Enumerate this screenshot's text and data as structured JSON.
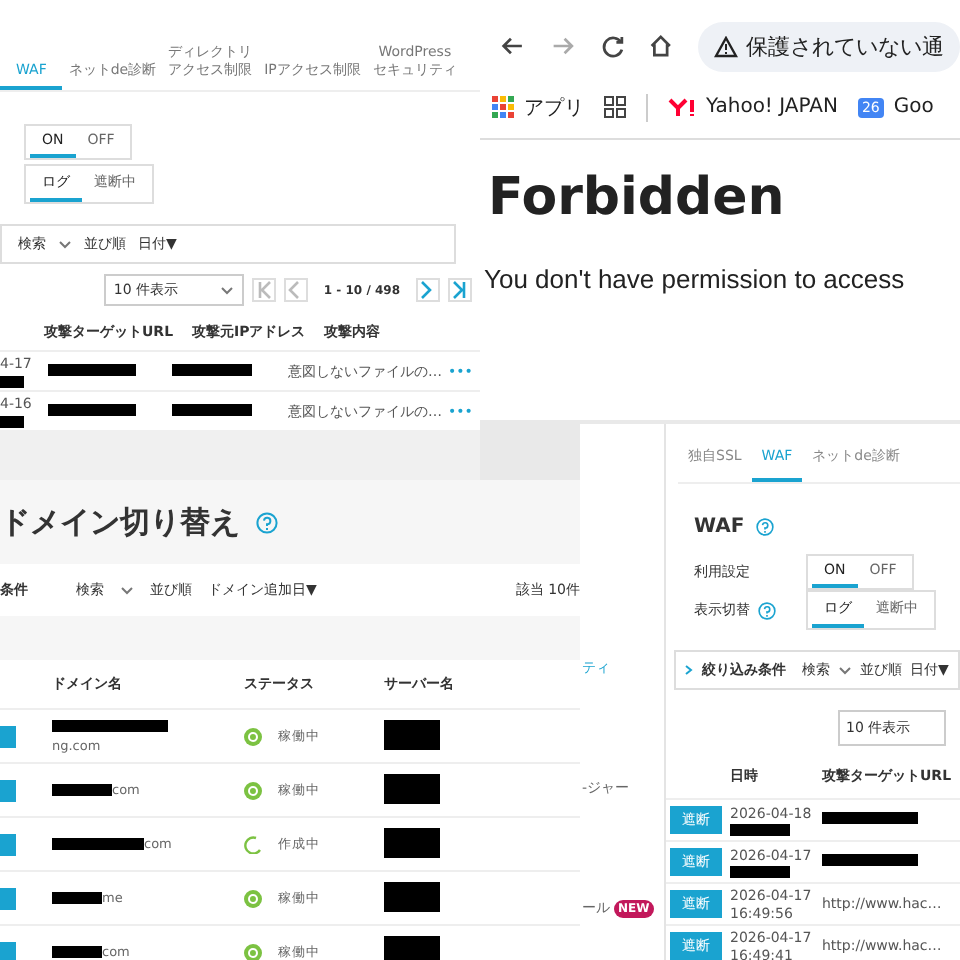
{
  "waf_screen": {
    "tabs": [
      {
        "lines": [
          "WAF"
        ],
        "selected": true
      },
      {
        "lines": [
          "ネットde診断"
        ],
        "selected": false
      },
      {
        "lines": [
          "ディレクトリ",
          "アクセス制限"
        ],
        "selected": false
      },
      {
        "lines": [
          "IPアクセス制限"
        ],
        "selected": false
      },
      {
        "lines": [
          "WordPress",
          "セキュリティ"
        ],
        "selected": false
      }
    ],
    "toggles": [
      [
        {
          "label": "ON",
          "selected": true
        },
        {
          "label": "OFF",
          "selected": false
        }
      ],
      [
        {
          "label": "ログ",
          "selected": true
        },
        {
          "label": "遮断中",
          "selected": false
        }
      ]
    ],
    "filter": {
      "search": "検索",
      "sort_label": "並び順",
      "sort_value": "日付▼"
    },
    "pagination": {
      "page_size": "10 件表示",
      "range": "1 - 10 / 498",
      "buttons": [
        {
          "kind": "first",
          "disabled": true
        },
        {
          "kind": "prev",
          "disabled": true
        },
        {
          "kind": "next",
          "disabled": false
        },
        {
          "kind": "last",
          "disabled": false
        }
      ]
    },
    "columns": [
      "攻撃ターゲットURL",
      "攻撃元IPアドレス",
      "攻撃内容"
    ],
    "rows": [
      {
        "date": "4-17",
        "detail": "意図しないファイルの…",
        "more": "•••"
      },
      {
        "date": "4-16",
        "detail": "意図しないファイルの…",
        "more": "•••"
      }
    ]
  },
  "browser": {
    "address": "保護されていない通",
    "bookmarks": [
      {
        "kind": "apps",
        "label": "アプリ"
      },
      {
        "kind": "grid"
      },
      {
        "kind": "yahoo",
        "label": "Yahoo! JAPAN"
      },
      {
        "kind": "calendar",
        "label": "Goo",
        "icon_text": "26"
      }
    ],
    "heading": "Forbidden",
    "message": "You don't have permission to access "
  },
  "domain_screen": {
    "title": "ドメイン切り替え",
    "filter": {
      "label": "条件",
      "search": "検索",
      "sort_label": "並び順",
      "sort_value": "ドメイン追加日▼",
      "count": "該当 10件"
    },
    "columns": [
      "ドメイン名",
      "ステータス",
      "サーバー名"
    ],
    "rows": [
      {
        "domain": "ng.com",
        "status": "稼働中",
        "kind": "running"
      },
      {
        "domain": "com",
        "status": "稼働中",
        "kind": "running"
      },
      {
        "domain": "com",
        "status": "作成中",
        "kind": "creating"
      },
      {
        "domain": "me",
        "status": "稼働中",
        "kind": "running"
      },
      {
        "domain": "com",
        "status": "稼働中",
        "kind": "running"
      }
    ]
  },
  "side_menu": {
    "items": [
      {
        "label": "ティ"
      },
      {
        "label": "-ジャー"
      },
      {
        "label": "ール",
        "badge": "NEW"
      }
    ]
  },
  "waf_screen_2": {
    "tabs": [
      {
        "label": "独自SSL",
        "selected": false
      },
      {
        "label": "WAF",
        "selected": true
      },
      {
        "label": "ネットde診断",
        "selected": false
      }
    ],
    "heading": "WAF",
    "settings": [
      {
        "label": "利用設定",
        "help": false,
        "options": [
          {
            "label": "ON",
            "selected": true
          },
          {
            "label": "OFF",
            "selected": false
          }
        ]
      },
      {
        "label": "表示切替",
        "help": true,
        "options": [
          {
            "label": "ログ",
            "selected": true
          },
          {
            "label": "遮断中",
            "selected": false
          }
        ]
      }
    ],
    "filter": {
      "label": "絞り込み条件",
      "search": "検索",
      "sort_label": "並び順",
      "sort_value": "日付▼"
    },
    "page_size": "10 件表示",
    "columns": [
      "日時",
      "攻撃ターゲットURL"
    ],
    "rows": [
      {
        "badge": "遮断",
        "date": "2026-04-18",
        "time": "",
        "url": ""
      },
      {
        "badge": "遮断",
        "date": "2026-04-17",
        "time": "",
        "url": ""
      },
      {
        "badge": "遮断",
        "date": "2026-04-17",
        "time": "16:49:56",
        "url": "http://www.hac…"
      },
      {
        "badge": "遮断",
        "date": "2026-04-17",
        "time": "16:49:41",
        "url": "http://www.hac…"
      }
    ]
  }
}
